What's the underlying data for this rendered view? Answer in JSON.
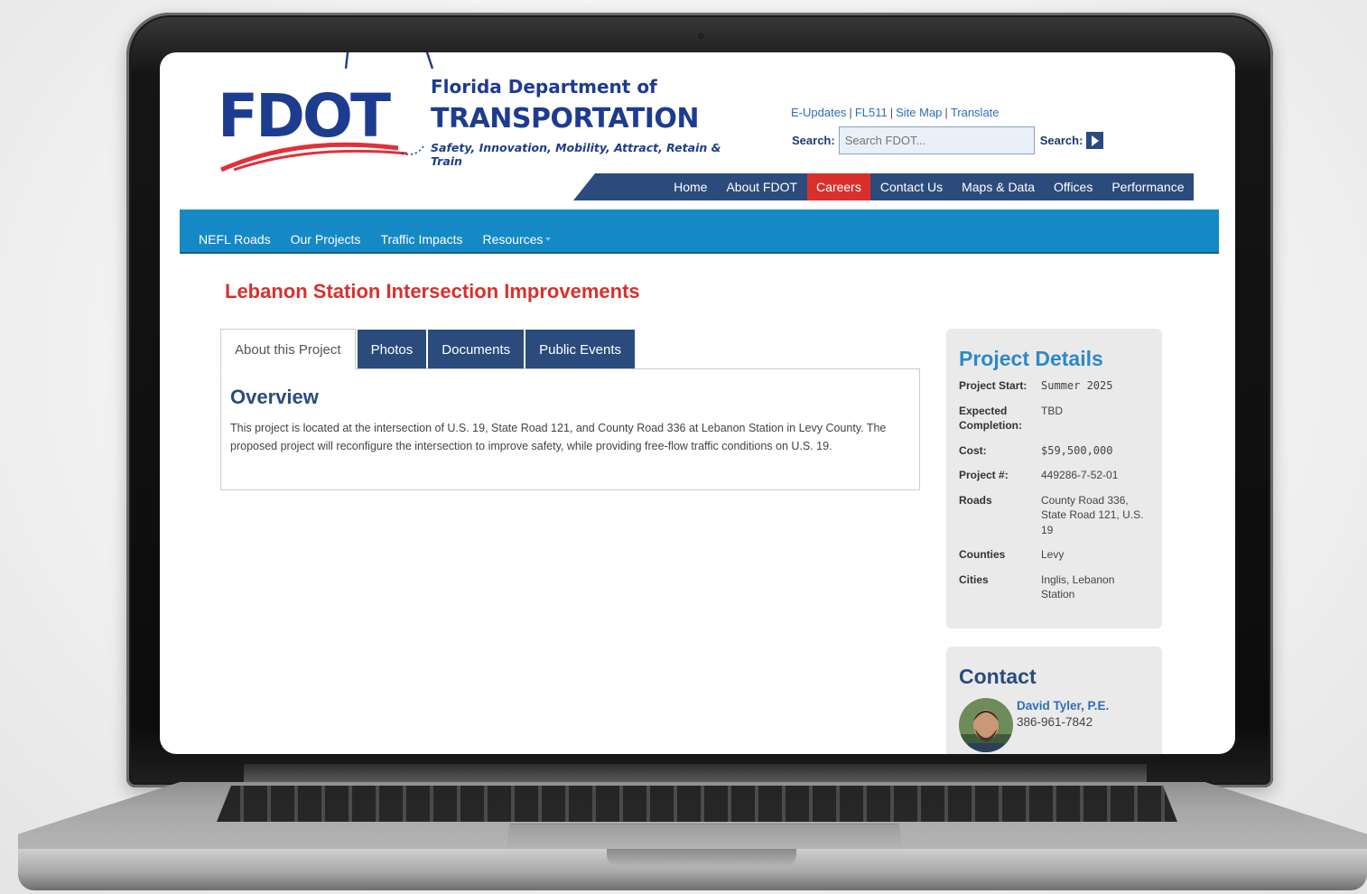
{
  "header": {
    "logo_text": "FDOT",
    "dept_line1": "Florida Department of",
    "dept_line2": "TRANSPORTATION",
    "tagline": "Safety, Innovation, Mobility, Attract, Retain & Train"
  },
  "utility_links": [
    "E-Updates",
    "FL511",
    "Site Map",
    "Translate"
  ],
  "search": {
    "label": "Search:",
    "placeholder": "Search FDOT...",
    "button_label": "Search:"
  },
  "main_nav": [
    {
      "label": "Home",
      "active": false
    },
    {
      "label": "About FDOT",
      "active": false
    },
    {
      "label": "Careers",
      "active": true
    },
    {
      "label": "Contact Us",
      "active": false
    },
    {
      "label": "Maps & Data",
      "active": false
    },
    {
      "label": "Offices",
      "active": false
    },
    {
      "label": "Performance",
      "active": false
    }
  ],
  "sub_nav": [
    "NEFL Roads",
    "Our Projects",
    "Traffic Impacts",
    "Resources"
  ],
  "page_title": "Lebanon Station Intersection Improvements",
  "tabs": [
    "About this Project",
    "Photos",
    "Documents",
    "Public Events"
  ],
  "overview": {
    "heading": "Overview",
    "text": "This project is located at the intersection of U.S. 19, State Road 121, and County Road 336 at Lebanon Station in Levy County. The proposed project will reconfigure the intersection to improve safety, while providing free-flow traffic conditions on U.S. 19."
  },
  "project_details": {
    "heading": "Project Details",
    "rows": [
      {
        "key": "Project Start:",
        "value": "Summer 2025"
      },
      {
        "key": "Expected Completion:",
        "value": "TBD"
      },
      {
        "key": "Cost:",
        "value": "$59,500,000"
      },
      {
        "key": "Project #:",
        "value": "449286-7-52-01"
      },
      {
        "key": "Roads",
        "value": "County Road 336, State Road 121, U.S. 19"
      },
      {
        "key": "Counties",
        "value": "Levy"
      },
      {
        "key": "Cities",
        "value": "Inglis, Lebanon Station"
      }
    ]
  },
  "contact": {
    "heading": "Contact",
    "name": "David Tyler, P.E.",
    "phone": "386-961-7842"
  },
  "colors": {
    "fdot_blue": "#1d3c8f",
    "nav_navy": "#2b4b7c",
    "active_red": "#d9302c",
    "subnav_blue": "#1589c6",
    "details_heading": "#2f88c7"
  }
}
